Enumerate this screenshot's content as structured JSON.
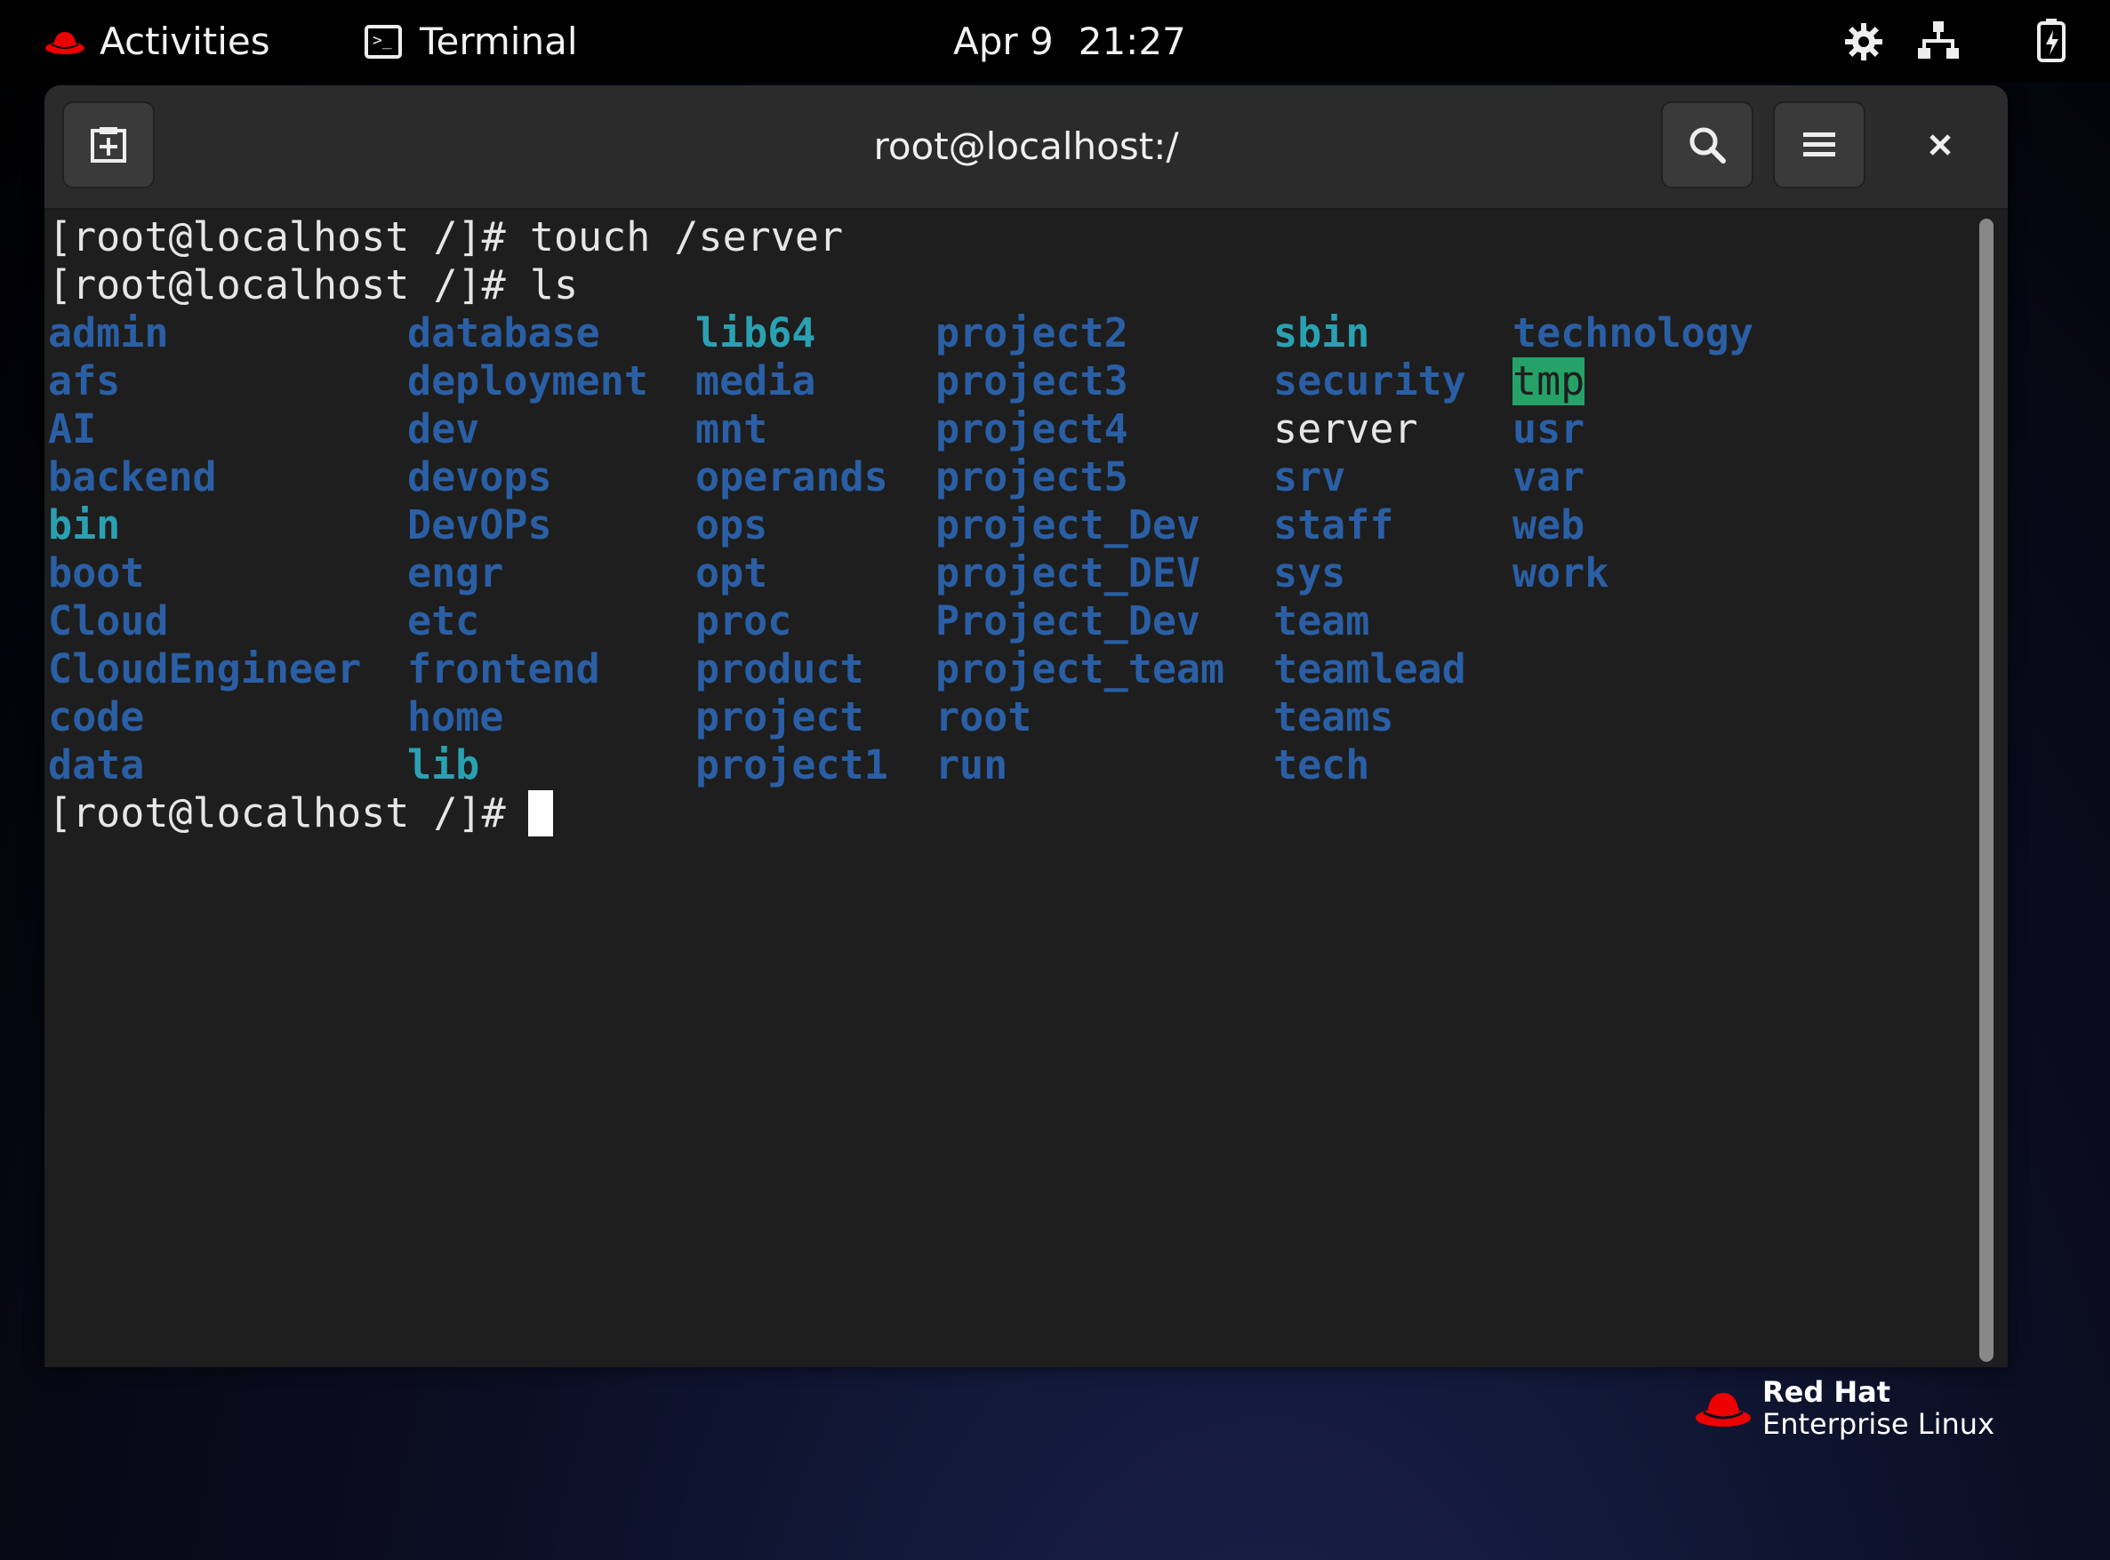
{
  "topbar": {
    "activities": "Activities",
    "app_name": "Terminal",
    "date": "Apr 9",
    "time": "21:27"
  },
  "window": {
    "title": "root@localhost:/"
  },
  "terminal": {
    "lines": [
      "[root@localhost /]# touch /server",
      "[root@localhost /]# ls"
    ],
    "prompt": "[root@localhost /]# ",
    "ls_columns": [
      [
        {
          "name": "admin",
          "style": "dir"
        },
        {
          "name": "afs",
          "style": "dir"
        },
        {
          "name": "AI",
          "style": "dir"
        },
        {
          "name": "backend",
          "style": "dir"
        },
        {
          "name": "bin",
          "style": "link"
        },
        {
          "name": "boot",
          "style": "dir"
        },
        {
          "name": "Cloud",
          "style": "dir"
        },
        {
          "name": "CloudEngineer",
          "style": "dir"
        },
        {
          "name": "code",
          "style": "dir"
        },
        {
          "name": "data",
          "style": "dir"
        }
      ],
      [
        {
          "name": "database",
          "style": "dir"
        },
        {
          "name": "deployment",
          "style": "dir"
        },
        {
          "name": "dev",
          "style": "dir"
        },
        {
          "name": "devops",
          "style": "dir"
        },
        {
          "name": "DevOPs",
          "style": "dir"
        },
        {
          "name": "engr",
          "style": "dir"
        },
        {
          "name": "etc",
          "style": "dir"
        },
        {
          "name": "frontend",
          "style": "dir"
        },
        {
          "name": "home",
          "style": "dir"
        },
        {
          "name": "lib",
          "style": "link"
        }
      ],
      [
        {
          "name": "lib64",
          "style": "link"
        },
        {
          "name": "media",
          "style": "dir"
        },
        {
          "name": "mnt",
          "style": "dir"
        },
        {
          "name": "operands",
          "style": "dir"
        },
        {
          "name": "ops",
          "style": "dir"
        },
        {
          "name": "opt",
          "style": "dir"
        },
        {
          "name": "proc",
          "style": "dir"
        },
        {
          "name": "product",
          "style": "dir"
        },
        {
          "name": "project",
          "style": "dir"
        },
        {
          "name": "project1",
          "style": "dir"
        }
      ],
      [
        {
          "name": "project2",
          "style": "dir"
        },
        {
          "name": "project3",
          "style": "dir"
        },
        {
          "name": "project4",
          "style": "dir"
        },
        {
          "name": "project5",
          "style": "dir"
        },
        {
          "name": "project_Dev",
          "style": "dir"
        },
        {
          "name": "project_DEV",
          "style": "dir"
        },
        {
          "name": "Project_Dev",
          "style": "dir"
        },
        {
          "name": "project_team",
          "style": "dir"
        },
        {
          "name": "root",
          "style": "dir"
        },
        {
          "name": "run",
          "style": "dir"
        }
      ],
      [
        {
          "name": "sbin",
          "style": "link"
        },
        {
          "name": "security",
          "style": "dir"
        },
        {
          "name": "server",
          "style": "file"
        },
        {
          "name": "srv",
          "style": "dir"
        },
        {
          "name": "staff",
          "style": "dir"
        },
        {
          "name": "sys",
          "style": "dir"
        },
        {
          "name": "team",
          "style": "dir"
        },
        {
          "name": "teamlead",
          "style": "dir"
        },
        {
          "name": "teams",
          "style": "dir"
        },
        {
          "name": "tech",
          "style": "dir"
        }
      ],
      [
        {
          "name": "technology",
          "style": "dir"
        },
        {
          "name": "tmp",
          "style": "sticky"
        },
        {
          "name": "usr",
          "style": "dir"
        },
        {
          "name": "var",
          "style": "dir"
        },
        {
          "name": "web",
          "style": "dir"
        },
        {
          "name": "work",
          "style": "dir"
        }
      ]
    ],
    "colors": {
      "dir": "#2a5fa5",
      "link": "#2aa1b3",
      "sticky_bg": "#26a269",
      "text": "#e6e6e6"
    }
  },
  "branding": {
    "brand": "Red Hat",
    "product": "Enterprise Linux"
  },
  "icons": {
    "activities": "redhat-fedora-icon",
    "app": "terminal-icon",
    "settings": "gear-icon",
    "network": "network-icon",
    "battery": "battery-charging-icon",
    "new_tab": "new-tab-icon",
    "search": "search-icon",
    "menu": "hamburger-menu-icon",
    "close": "close-icon"
  }
}
